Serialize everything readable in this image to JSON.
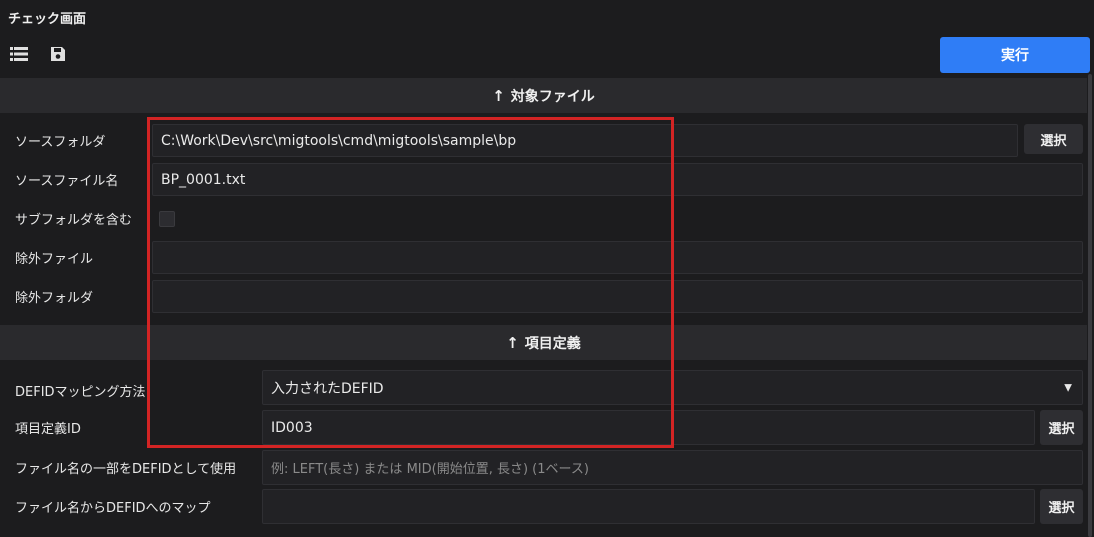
{
  "window": {
    "title": "チェック画面"
  },
  "toolbar": {
    "list_icon": "list-icon",
    "save_icon": "floppy-save-icon",
    "execute_label": "実行",
    "accent": "#2f7df6"
  },
  "sections": {
    "target_files": {
      "title": "対象ファイル",
      "arrow": "↑",
      "source_folder": {
        "label": "ソースフォルダ",
        "value": "C:\\Work\\Dev\\src\\migtools\\cmd\\migtools\\sample\\bp",
        "button": "選択"
      },
      "source_file_name": {
        "label": "ソースファイル名",
        "value": "BP_0001.txt"
      },
      "include_subfolders": {
        "label": "サブフォルダを含む",
        "checked": false
      },
      "exclude_files": {
        "label": "除外ファイル",
        "value": ""
      },
      "exclude_folders": {
        "label": "除外フォルダ",
        "value": ""
      }
    },
    "item_definition": {
      "title": "項目定義",
      "arrow": "↑",
      "defid_mapping": {
        "label": "DEFIDマッピング方法",
        "value": "入力されたDEFID"
      },
      "item_def_id": {
        "label": "項目定義ID",
        "value": "ID003",
        "button": "選択"
      },
      "filename_part": {
        "label": "ファイル名の一部をDEFIDとして使用",
        "placeholder": "例: LEFT(長さ) または  MID(開始位置, 長さ) (1ベース)"
      },
      "filename_map": {
        "label": "ファイル名からDEFIDへのマップ",
        "value": "",
        "button": "選択"
      }
    }
  },
  "highlight_color": "#d32424"
}
